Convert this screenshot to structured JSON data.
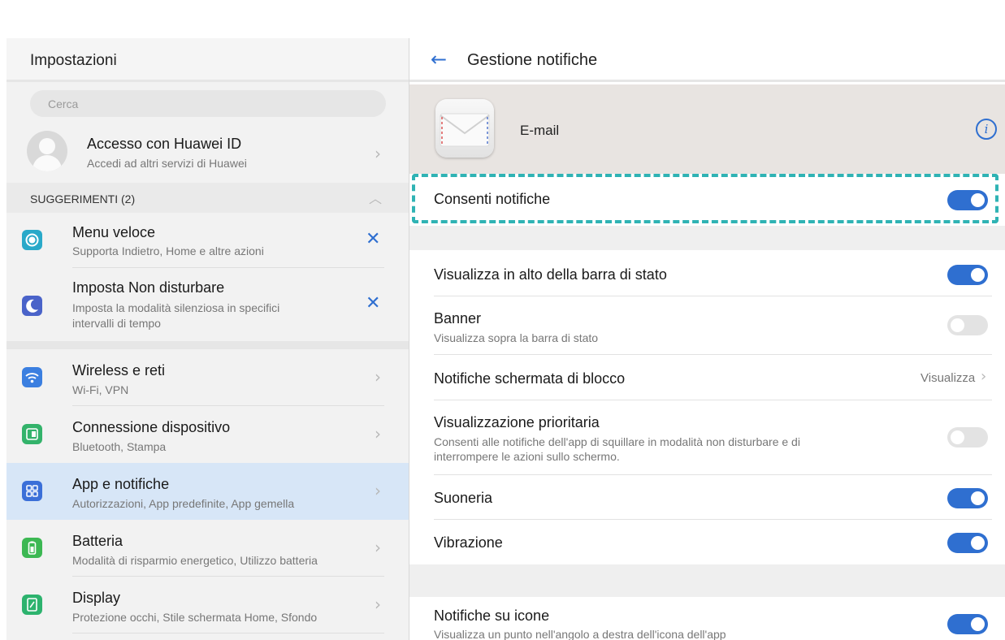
{
  "left": {
    "title": "Impostazioni",
    "search_placeholder": "Cerca",
    "account": {
      "title": "Accesso con Huawei ID",
      "subtitle": "Accedi ad altri servizi di Huawei"
    },
    "suggestions_header": "SUGGERIMENTI (2)",
    "suggestions": [
      {
        "title": "Menu veloce",
        "subtitle": "Supporta Indietro, Home e altre azioni",
        "icon": "quick-menu-icon",
        "color": "#29a9c9"
      },
      {
        "title": "Imposta Non disturbare",
        "subtitle_line1": "Imposta la modalità silenziosa in specifici",
        "subtitle_line2": "intervalli di tempo",
        "icon": "moon-icon",
        "color": "#4a63c9"
      }
    ],
    "items": [
      {
        "title": "Wireless e reti",
        "subtitle": "Wi-Fi, VPN",
        "icon": "wifi-icon",
        "color": "#3b7fe0"
      },
      {
        "title": "Connessione dispositivo",
        "subtitle": "Bluetooth, Stampa",
        "icon": "device-connection-icon",
        "color": "#33b36b"
      },
      {
        "title": "App e notifiche",
        "subtitle": "Autorizzazioni, App predefinite, App gemella",
        "icon": "apps-icon",
        "color": "#3b6fd8",
        "selected": true
      },
      {
        "title": "Batteria",
        "subtitle": "Modalità di risparmio energetico, Utilizzo batteria",
        "icon": "battery-icon",
        "color": "#3cb853"
      },
      {
        "title": "Display",
        "subtitle": "Protezione occhi, Stile schermata Home, Sfondo",
        "icon": "display-icon",
        "color": "#2db36e"
      }
    ]
  },
  "right": {
    "title": "Gestione notifiche",
    "app_name": "E-mail",
    "allow_notifications": {
      "label": "Consenti notifiche",
      "on": true
    },
    "settings": [
      {
        "title": "Visualizza in alto della barra di stato",
        "on": true
      },
      {
        "title": "Banner",
        "subtitle": "Visualizza sopra la barra di stato",
        "on": false
      },
      {
        "title": "Notifiche schermata di blocco",
        "value": "Visualizza"
      },
      {
        "title": "Visualizzazione prioritaria",
        "subtitle_line1": "Consenti alle notifiche dell'app di squillare in modalità non disturbare e di",
        "subtitle_line2": "interrompere le azioni sullo schermo.",
        "on": false
      },
      {
        "title": "Suoneria",
        "on": true
      },
      {
        "title": "Vibrazione",
        "on": true
      }
    ],
    "icon_badges": {
      "title": "Notifiche su icone",
      "subtitle": "Visualizza un punto nell'angolo a destra dell'icona dell'app",
      "on": true
    }
  },
  "colors": {
    "accent": "#2f6fd0",
    "highlight": "#2fb3b4",
    "selected_row": "#d7e6f7"
  }
}
